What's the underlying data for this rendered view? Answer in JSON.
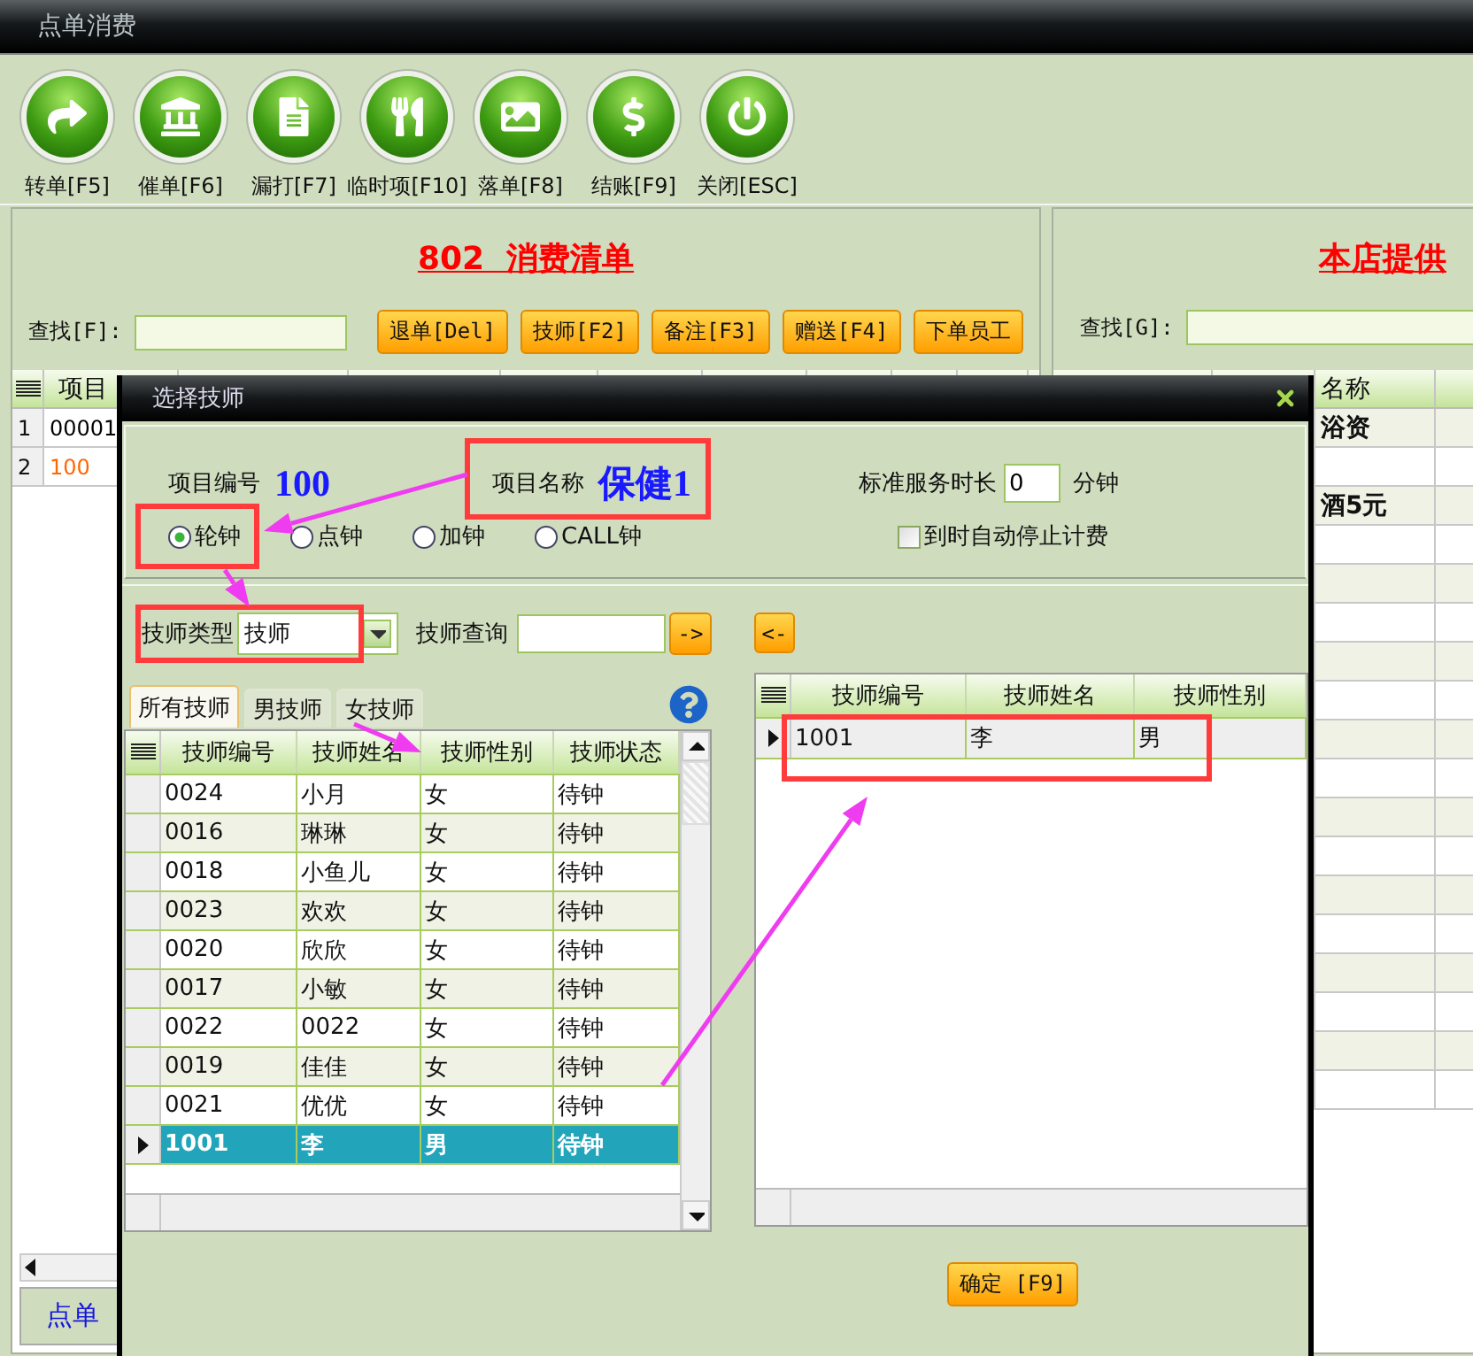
{
  "window": {
    "title": "点单消费"
  },
  "toolbar": [
    "转单[F5]",
    "催单[F6]",
    "漏打[F7]",
    "临时项[F10]",
    "落单[F8]",
    "结账[F9]",
    "关闭[ESC]"
  ],
  "order_panel": {
    "title": "802  消费清单",
    "search_label": "查找[F]:",
    "buttons": [
      "退单[Del]",
      "技师[F2]",
      "备注[F3]",
      "赠送[F4]",
      "下单员工"
    ],
    "table": {
      "column_1": "项目",
      "rows": [
        {
          "number": "1",
          "code": "00001",
          "color": "#000000"
        },
        {
          "number": "2",
          "code": "100",
          "color": "#ff6600"
        }
      ]
    },
    "status": "点单"
  },
  "catalog_panel": {
    "title": "本店提供",
    "search_label": "查找[G]:",
    "table": {
      "column_3": "名称",
      "rows": [
        {
          "kind": "item",
          "name": "浴资"
        },
        {
          "kind": "blank"
        },
        {
          "kind": "item",
          "name": "酒5元"
        }
      ]
    }
  },
  "dialog": {
    "title": "选择技师",
    "item_code_label": "项目编号",
    "item_code": "100",
    "item_name_label": "项目名称",
    "item_name": "保健1",
    "duration_label": "标准服务时长",
    "duration": "0",
    "duration_unit": "分钟",
    "clock_types": [
      {
        "label": "轮钟",
        "selected": true
      },
      {
        "label": "点钟",
        "selected": false
      },
      {
        "label": "加钟",
        "selected": false
      },
      {
        "label": "CALL钟",
        "selected": false
      }
    ],
    "auto_stop": {
      "label": "到时自动停止计费",
      "checked": false
    },
    "type_label": "技师类型",
    "type_value": "技师",
    "query_label": "技师查询",
    "add_button": "->",
    "remove_button": "<-",
    "tabs": [
      {
        "label": "所有技师",
        "selected": true
      },
      {
        "label": "男技师",
        "selected": false
      },
      {
        "label": "女技师",
        "selected": false
      }
    ],
    "available": {
      "columns": [
        "技师编号",
        "技师姓名",
        "技师性别",
        "技师状态"
      ],
      "rows": [
        {
          "cells": [
            "0024",
            "小月",
            "女",
            "待钟"
          ],
          "selected": false
        },
        {
          "cells": [
            "0016",
            "琳琳",
            "女",
            "待钟"
          ],
          "selected": false
        },
        {
          "cells": [
            "0018",
            "小鱼儿",
            "女",
            "待钟"
          ],
          "selected": false
        },
        {
          "cells": [
            "0023",
            "欢欢",
            "女",
            "待钟"
          ],
          "selected": false
        },
        {
          "cells": [
            "0020",
            "欣欣",
            "女",
            "待钟"
          ],
          "selected": false
        },
        {
          "cells": [
            "0017",
            "小敏",
            "女",
            "待钟"
          ],
          "selected": false
        },
        {
          "cells": [
            "0022",
            "0022",
            "女",
            "待钟"
          ],
          "selected": false
        },
        {
          "cells": [
            "0019",
            "佳佳",
            "女",
            "待钟"
          ],
          "selected": false
        },
        {
          "cells": [
            "0021",
            "优优",
            "女",
            "待钟"
          ],
          "selected": false
        },
        {
          "cells": [
            "1001",
            "李",
            "男",
            "待钟"
          ],
          "selected": true
        }
      ]
    },
    "assigned": {
      "columns": [
        "技师编号",
        "技师姓名",
        "技师性别"
      ],
      "rows": [
        {
          "cells": [
            "1001",
            "李",
            "男"
          ],
          "selected": true
        }
      ]
    },
    "confirm_button": "确定 [F9]"
  }
}
